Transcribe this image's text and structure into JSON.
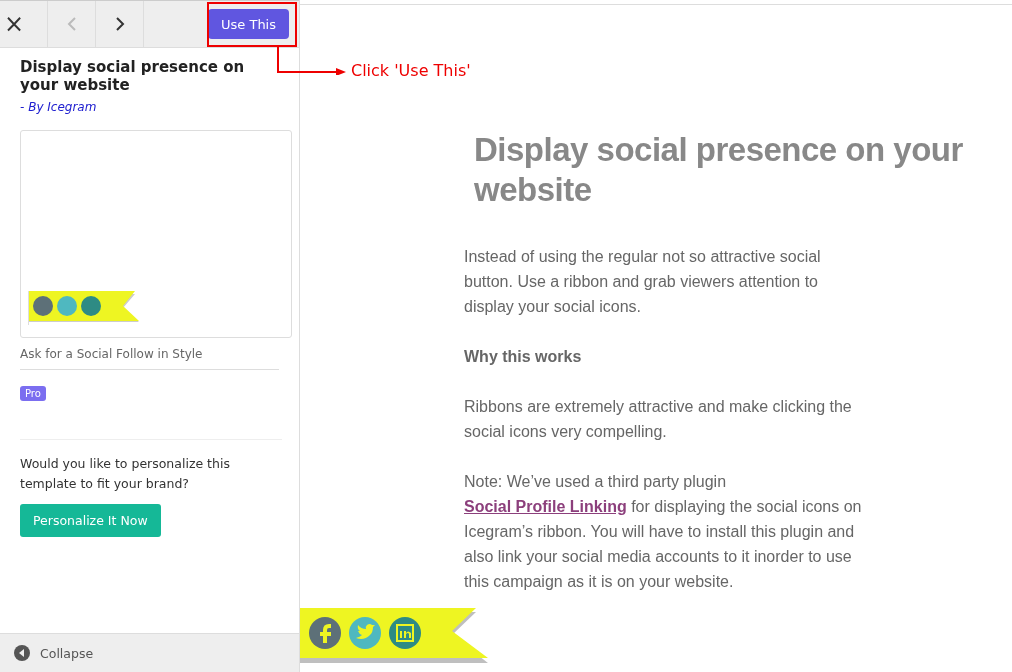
{
  "toolbar": {
    "close": "×",
    "prev_disabled": true,
    "next_disabled": false,
    "use_button": "Use This"
  },
  "annotation": {
    "text": "Click 'Use This'"
  },
  "sidebar": {
    "title": "Display social presence on your website",
    "author": "- By Icegram",
    "preview": {
      "kind": "ribbon"
    },
    "subtitle": "Ask for a Social Follow in Style",
    "badge": "Pro",
    "prompt": "Would you like to personalize this template to fit your brand?",
    "personalize_button": "Personalize It Now",
    "collapse": "Collapse"
  },
  "content": {
    "heading": "Display social presence on your website",
    "paragraphs": [
      {
        "kind": "text",
        "text": "Instead of using the regular not so attractive social button. Use a ribbon and grab viewers attention to display your social icons."
      },
      {
        "kind": "bold",
        "text": "Why this works"
      },
      {
        "kind": "text",
        "text": "Ribbons are extremely attractive and make clicking the social icons very compelling."
      },
      {
        "kind": "note",
        "before": "Note: We’ve used a third party plugin ",
        "link": "Social Profile Linking",
        "after": " for displaying the social icons on Icegram’s ribbon. You will have to install this plugin and also link your social media accounts to it inorder to use this campaign as it is on your website."
      }
    ]
  }
}
